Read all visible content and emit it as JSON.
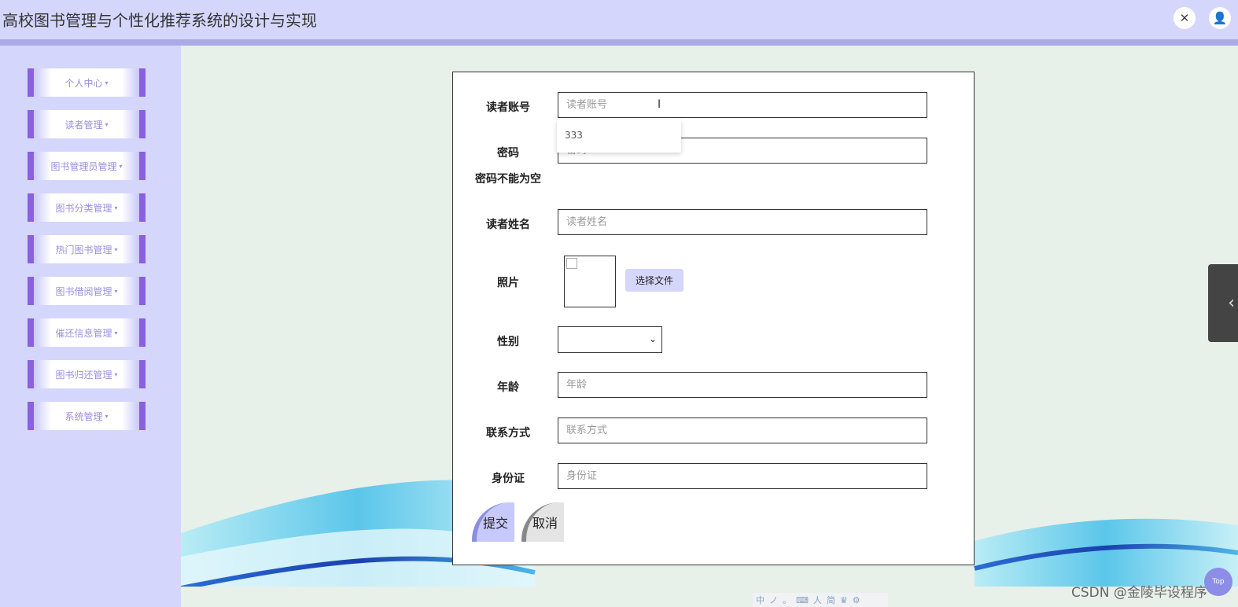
{
  "header": {
    "title": "高校图书管理与个性化推荐系统的设计与实现",
    "fullscreen_icon": "✕",
    "user_icon": "👤"
  },
  "sidebar": {
    "items": [
      {
        "label": "个人中心"
      },
      {
        "label": "读者管理"
      },
      {
        "label": "图书管理员管理"
      },
      {
        "label": "图书分类管理"
      },
      {
        "label": "热门图书管理"
      },
      {
        "label": "图书借阅管理"
      },
      {
        "label": "催还信息管理"
      },
      {
        "label": "图书归还管理"
      },
      {
        "label": "系统管理"
      }
    ],
    "caret": "▾"
  },
  "form": {
    "account": {
      "label": "读者账号",
      "placeholder": "读者账号",
      "value": ""
    },
    "autocomplete": {
      "option": "333"
    },
    "password": {
      "label": "密码",
      "placeholder": "密码",
      "error": "密码不能为空"
    },
    "name": {
      "label": "读者姓名",
      "placeholder": "读者姓名"
    },
    "photo": {
      "label": "照片",
      "choose_label": "选择文件"
    },
    "gender": {
      "label": "性别",
      "value": ""
    },
    "age": {
      "label": "年龄",
      "placeholder": "年龄"
    },
    "contact": {
      "label": "联系方式",
      "placeholder": "联系方式"
    },
    "idcard": {
      "label": "身份证",
      "placeholder": "身份证"
    },
    "submit_label": "提交",
    "cancel_label": "取消"
  },
  "side_tab": {
    "arrow": "‹"
  },
  "top_button": {
    "label": "Top"
  },
  "watermark": "CSDN @金陵毕设程序",
  "ime": {
    "items": [
      "中",
      "ノ",
      "。",
      "⌨",
      "人",
      "简",
      "♛",
      "⚙"
    ]
  },
  "colors": {
    "header_bg": "#d5d6fb",
    "accent": "#8a5fe0",
    "main_bg": "#e8f0ea"
  }
}
